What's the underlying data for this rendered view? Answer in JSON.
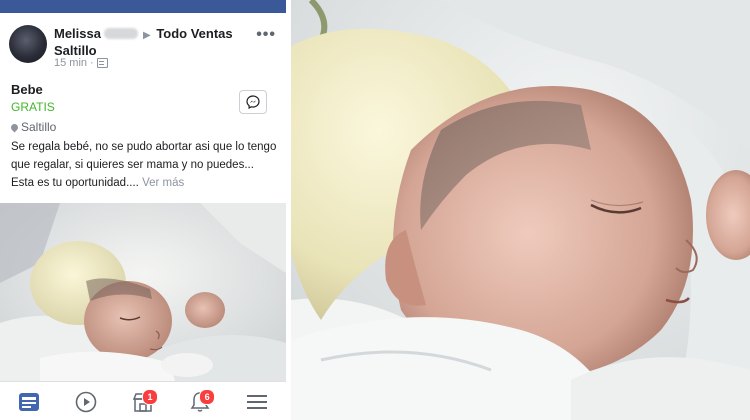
{
  "post": {
    "author": "Melissa",
    "arrow": "▶",
    "group": "Todo Ventas",
    "group_line2": "Saltillo",
    "time": "15 min",
    "more_label": "•••"
  },
  "listing": {
    "title": "Bebe",
    "price": "GRATIS",
    "location": "Saltillo",
    "description": "Se regala bebé, no se pudo abortar asi que lo tengo que regalar, si quieres ser mama y no puedes... Esta es tu oportunidad....",
    "see_more": "Ver más"
  },
  "nav": {
    "marketplace_badge": "1",
    "notifications_badge": "6"
  },
  "colors": {
    "facebook_blue": "#3b5998",
    "price_green": "#42b72a",
    "badge_red": "#fa3e3e",
    "nav_active": "#4267b2"
  },
  "icons": [
    "more-icon",
    "globe-icon",
    "location-pin-icon",
    "messenger-icon",
    "news-feed-icon",
    "watch-icon",
    "marketplace-icon",
    "notifications-icon",
    "menu-icon"
  ]
}
